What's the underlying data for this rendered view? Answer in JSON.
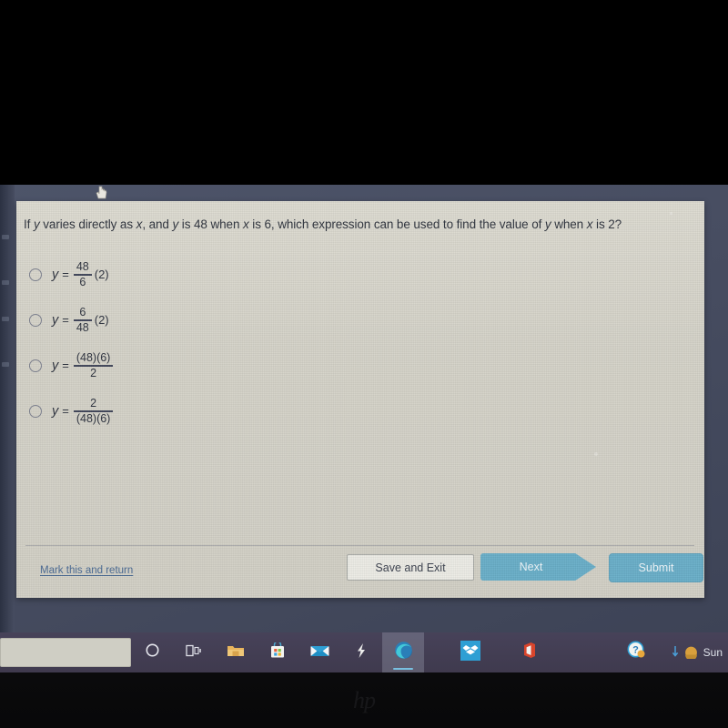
{
  "question": {
    "text": "If y varies directly as x, and y is 48 when x is 6, which expression can be used to find the value of y when x is 2?"
  },
  "choices": [
    {
      "id": "choice-a",
      "variable": "y",
      "equals": "=",
      "numerator": "48",
      "denominator": "6",
      "trailing": "(2)",
      "selected": false
    },
    {
      "id": "choice-b",
      "variable": "y",
      "equals": "=",
      "numerator": "6",
      "denominator": "48",
      "trailing": "(2)",
      "selected": false
    },
    {
      "id": "choice-c",
      "variable": "y",
      "equals": "=",
      "numerator": "(48)(6)",
      "denominator": "2",
      "trailing": "",
      "selected": false
    },
    {
      "id": "choice-d",
      "variable": "y",
      "equals": "=",
      "numerator": "2",
      "denominator": "(48)(6)",
      "trailing": "",
      "selected": false
    }
  ],
  "actions": {
    "mark_link": "Mark this and return",
    "save_label": "Save and Exit",
    "next_label": "Next",
    "submit_label": "Submit"
  },
  "colors": {
    "panel_bg": "#d6d4ca",
    "accent_blue": "#6aafc9",
    "link_blue": "#4a6a93",
    "text_dark": "#30353f",
    "desktop": "#474d61",
    "taskbar": "#474259"
  },
  "taskbar": {
    "search_placeholder": "",
    "search_value": "",
    "items": [
      {
        "name": "cortana-icon",
        "label": "Cortana",
        "active": false
      },
      {
        "name": "task-view-icon",
        "label": "Task View",
        "active": false
      },
      {
        "name": "file-explorer-icon",
        "label": "File Explorer",
        "active": false
      },
      {
        "name": "microsoft-store-icon",
        "label": "Microsoft Store",
        "active": false
      },
      {
        "name": "mail-icon",
        "label": "Mail",
        "active": false
      },
      {
        "name": "lightning-icon",
        "label": "Quick Assist",
        "active": false
      },
      {
        "name": "edge-icon",
        "label": "Microsoft Edge",
        "active": true
      },
      {
        "name": "dropbox-icon",
        "label": "Dropbox",
        "active": false
      },
      {
        "name": "office-icon",
        "label": "Office",
        "active": false
      },
      {
        "name": "help-icon",
        "label": "Get Help",
        "active": false
      }
    ],
    "weather": {
      "icon": "weather-sun-icon",
      "text": "Sun"
    }
  },
  "device": {
    "brand_logo": "hp"
  }
}
